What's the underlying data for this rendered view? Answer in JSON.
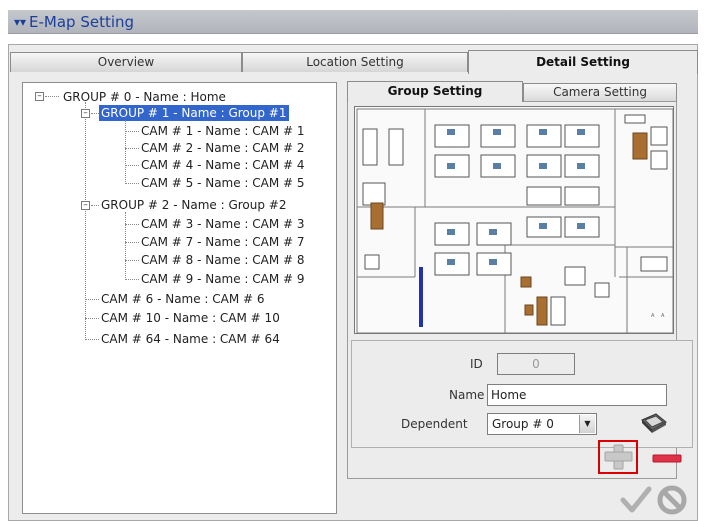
{
  "window": {
    "title": "E-Map Setting",
    "icon": "emap-icon"
  },
  "tabs": [
    {
      "label": "Overview"
    },
    {
      "label": "Location Setting"
    },
    {
      "label": "Detail Setting",
      "active": true
    }
  ],
  "tree": {
    "nodes": [
      {
        "label": "GROUP # 0 - Name : Home"
      },
      {
        "label": "GROUP # 1 - Name : Group #1",
        "selected": true
      },
      {
        "label": "CAM # 1 - Name : CAM # 1"
      },
      {
        "label": "CAM # 2 - Name : CAM # 2"
      },
      {
        "label": "CAM # 4 - Name : CAM # 4"
      },
      {
        "label": "CAM # 5 - Name : CAM # 5"
      },
      {
        "label": "GROUP # 2 - Name : Group #2"
      },
      {
        "label": "CAM # 3 - Name : CAM # 3"
      },
      {
        "label": "CAM # 7 - Name : CAM # 7"
      },
      {
        "label": "CAM # 8 - Name : CAM # 8"
      },
      {
        "label": "CAM # 9 - Name : CAM # 9"
      },
      {
        "label": "CAM # 6 - Name : CAM # 6"
      },
      {
        "label": "CAM # 10 - Name : CAM # 10"
      },
      {
        "label": "CAM # 64 - Name : CAM # 64"
      }
    ]
  },
  "subtabs": [
    {
      "label": "Group Setting",
      "active": true
    },
    {
      "label": "Camera Setting"
    }
  ],
  "form": {
    "id_label": "ID",
    "id_value": "0",
    "name_label": "Name",
    "name_value": "Home",
    "dependent_label": "Dependent",
    "dependent_value": "Group # 0"
  },
  "colors": {
    "accent": "#3366cc",
    "title_text": "#1a3f9c",
    "remove": "#e0314a",
    "highlight_box": "#d90000"
  },
  "icons": {
    "expand": "minus-box-icon",
    "map_image": "floor-plan-icon",
    "dependent_action": "map-stack-icon",
    "add": "plus-icon",
    "remove": "minus-icon",
    "confirm": "checkmark-icon",
    "cancel": "cancel-icon"
  }
}
